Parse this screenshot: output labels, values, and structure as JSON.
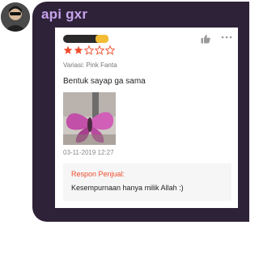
{
  "chat": {
    "username": "api gxr"
  },
  "review": {
    "rating": 2,
    "rating_max": 5,
    "variant": "Variasi: Pink Fanta",
    "comment": "Bentuk sayap ga sama",
    "date": "03-11-2019 12:27",
    "seller_response_label": "Respon Penjual:",
    "seller_response_text": "Kesempurnaan hanya milik Allah :)"
  },
  "colors": {
    "bubble": "#2e2238",
    "username": "#c8a4ee",
    "star_filled": "#ee4d2d",
    "seller_label": "#ee4d2d",
    "badge": "#f2bd34"
  },
  "icons": [
    "like-icon",
    "more-icon",
    "star-icon"
  ]
}
